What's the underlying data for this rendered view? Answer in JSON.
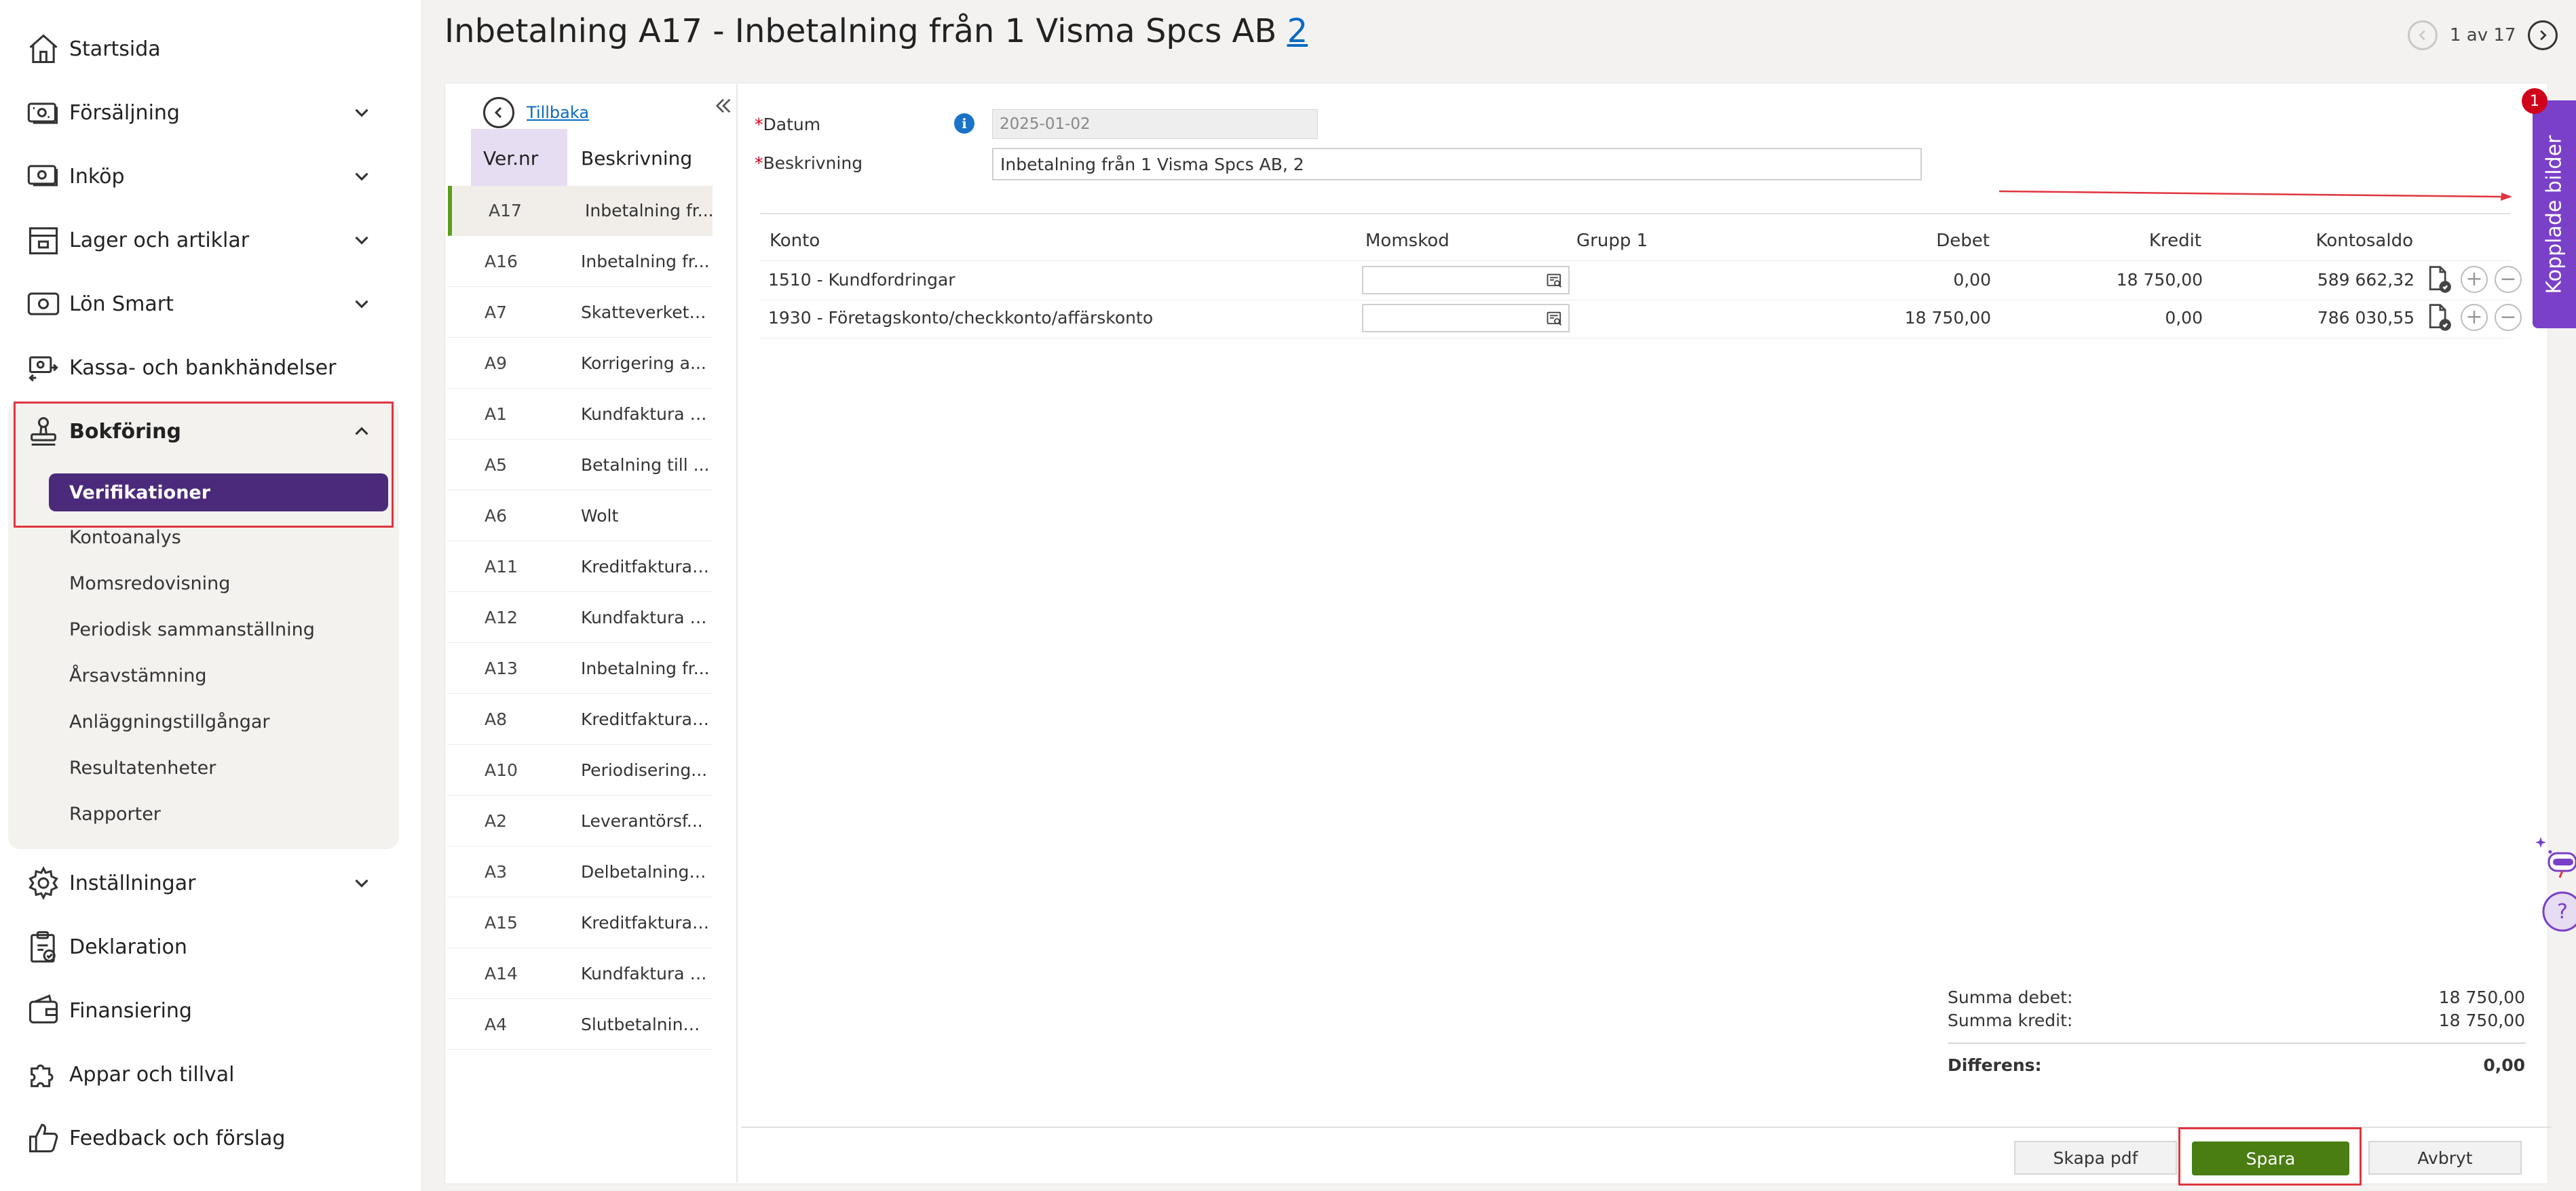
{
  "sidebar": {
    "items": [
      {
        "label": "Startsida",
        "icon": "home-icon"
      },
      {
        "label": "Försäljning",
        "icon": "sales-icon"
      },
      {
        "label": "Inköp",
        "icon": "purchase-icon"
      },
      {
        "label": "Lager och artiklar",
        "icon": "inventory-icon"
      },
      {
        "label": "Lön Smart",
        "icon": "payroll-icon"
      },
      {
        "label": "Kassa- och bankhändelser",
        "icon": "cash-register-icon"
      },
      {
        "label": "Bokföring",
        "icon": "stamp-icon"
      },
      {
        "label": "Inställningar",
        "icon": "gear-icon"
      },
      {
        "label": "Deklaration",
        "icon": "declaration-icon"
      },
      {
        "label": "Finansiering",
        "icon": "wallet-icon"
      },
      {
        "label": "Appar och tillval",
        "icon": "puzzle-icon"
      },
      {
        "label": "Feedback och förslag",
        "icon": "thumbs-up-icon"
      }
    ],
    "bokforing_sub": [
      "Verifikationer",
      "Kontoanalys",
      "Momsredovisning",
      "Periodisk sammanställning",
      "Årsavstämning",
      "Anläggningstillgångar",
      "Resultatenheter",
      "Rapporter"
    ]
  },
  "header": {
    "title": "Inbetalning A17  -  Inbetalning från 1 Visma Spcs AB ",
    "title_link": "2",
    "pager": "1 av 17"
  },
  "list": {
    "back_label": "Tillbaka",
    "col_vernr": "Ver.nr",
    "col_besk": "Beskrivning",
    "rows": [
      {
        "vernr": "A17",
        "desc": "Inbetalning fr..."
      },
      {
        "vernr": "A16",
        "desc": "Inbetalning fr..."
      },
      {
        "vernr": "A7",
        "desc": "Skatteverket (..."
      },
      {
        "vernr": "A9",
        "desc": "Korrigering a..."
      },
      {
        "vernr": "A1",
        "desc": "Kundfaktura t..."
      },
      {
        "vernr": "A5",
        "desc": "Betalning till ..."
      },
      {
        "vernr": "A6",
        "desc": "Wolt"
      },
      {
        "vernr": "A11",
        "desc": "Kreditfaktura ..."
      },
      {
        "vernr": "A12",
        "desc": "Kundfaktura t..."
      },
      {
        "vernr": "A13",
        "desc": "Inbetalning fr..."
      },
      {
        "vernr": "A8",
        "desc": "Kreditfaktura ..."
      },
      {
        "vernr": "A10",
        "desc": "Periodisering..."
      },
      {
        "vernr": "A2",
        "desc": "Leverantörsf..."
      },
      {
        "vernr": "A3",
        "desc": "Delbetalning ..."
      },
      {
        "vernr": "A15",
        "desc": "Kreditfaktura ..."
      },
      {
        "vernr": "A14",
        "desc": "Kundfaktura t..."
      },
      {
        "vernr": "A4",
        "desc": "Slutbetalning ..."
      }
    ]
  },
  "form": {
    "datum_label": "Datum",
    "datum_value": "2025-01-02",
    "besk_label": "Beskrivning",
    "besk_value": "Inbetalning från 1 Visma Spcs AB, 2"
  },
  "table": {
    "headers": {
      "konto": "Konto",
      "momskod": "Momskod",
      "grupp": "Grupp 1",
      "debet": "Debet",
      "kredit": "Kredit",
      "saldo": "Kontosaldo"
    },
    "rows": [
      {
        "konto": "1510 - Kundfordringar",
        "debet": "0,00",
        "kredit": "18 750,00",
        "saldo": "589 662,32"
      },
      {
        "konto": "1930 - Företagskonto/checkkonto/affärskonto",
        "debet": "18 750,00",
        "kredit": "0,00",
        "saldo": "786 030,55"
      }
    ]
  },
  "totals": {
    "debet_label": "Summa debet:",
    "debet_value": "18 750,00",
    "kredit_label": "Summa kredit:",
    "kredit_value": "18 750,00",
    "diff_label": "Differens:",
    "diff_value": "0,00"
  },
  "footer": {
    "pdf": "Skapa pdf",
    "save": "Spara",
    "cancel": "Avbryt"
  },
  "kopplade": {
    "label": "Kopplade bilder",
    "badge": "1"
  },
  "colors": {
    "brand_purple": "#4b2a7b",
    "tab_purple": "#7a40c8",
    "save_green": "#4a7d12",
    "highlight_red": "#e0353f",
    "link_blue": "#0a6bc4"
  }
}
